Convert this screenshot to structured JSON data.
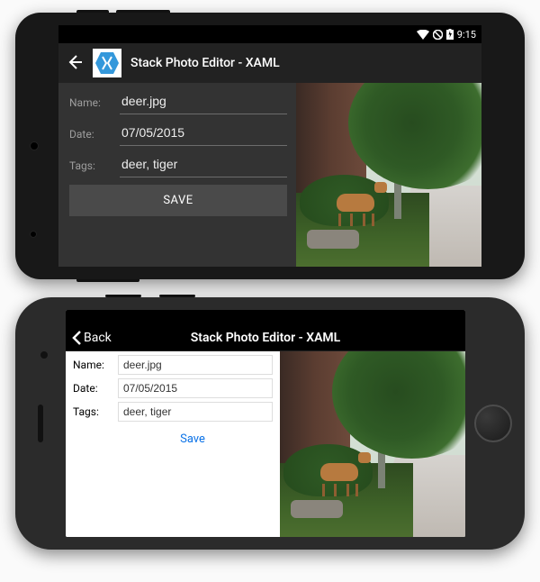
{
  "android": {
    "status": {
      "time": "9:15"
    },
    "toolbar": {
      "title": "Stack Photo Editor - XAML"
    },
    "form": {
      "name_label": "Name:",
      "name_value": "deer.jpg",
      "date_label": "Date:",
      "date_value": "07/05/2015",
      "tags_label": "Tags:",
      "tags_value": "deer, tiger",
      "save_label": "SAVE"
    }
  },
  "ios": {
    "nav": {
      "back_label": "Back",
      "title": "Stack Photo Editor - XAML"
    },
    "form": {
      "name_label": "Name:",
      "name_value": "deer.jpg",
      "date_label": "Date:",
      "date_value": "07/05/2015",
      "tags_label": "Tags:",
      "tags_value": "deer, tiger",
      "save_label": "Save"
    }
  }
}
